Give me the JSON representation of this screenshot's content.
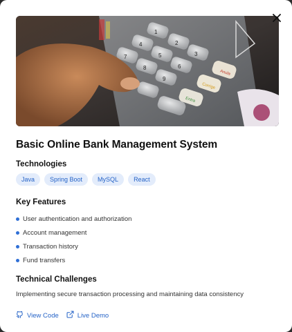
{
  "project": {
    "title": "Basic Online Bank Management System",
    "hero_image_icon": "atm-keypad-photo"
  },
  "technologies": {
    "heading": "Technologies",
    "tags": [
      "Java",
      "Spring Boot",
      "MySQL",
      "React"
    ]
  },
  "features": {
    "heading": "Key Features",
    "items": [
      "User authentication and authorization",
      "Account management",
      "Transaction history",
      "Fund transfers"
    ]
  },
  "challenges": {
    "heading": "Technical Challenges",
    "text": "Implementing secure transaction processing and maintaining data consistency"
  },
  "links": {
    "view_code": "View Code",
    "live_demo": "Live Demo"
  },
  "colors": {
    "accent": "#2563c7",
    "tag_background": "#e3ecfb",
    "bullet": "#2f6fd6"
  }
}
